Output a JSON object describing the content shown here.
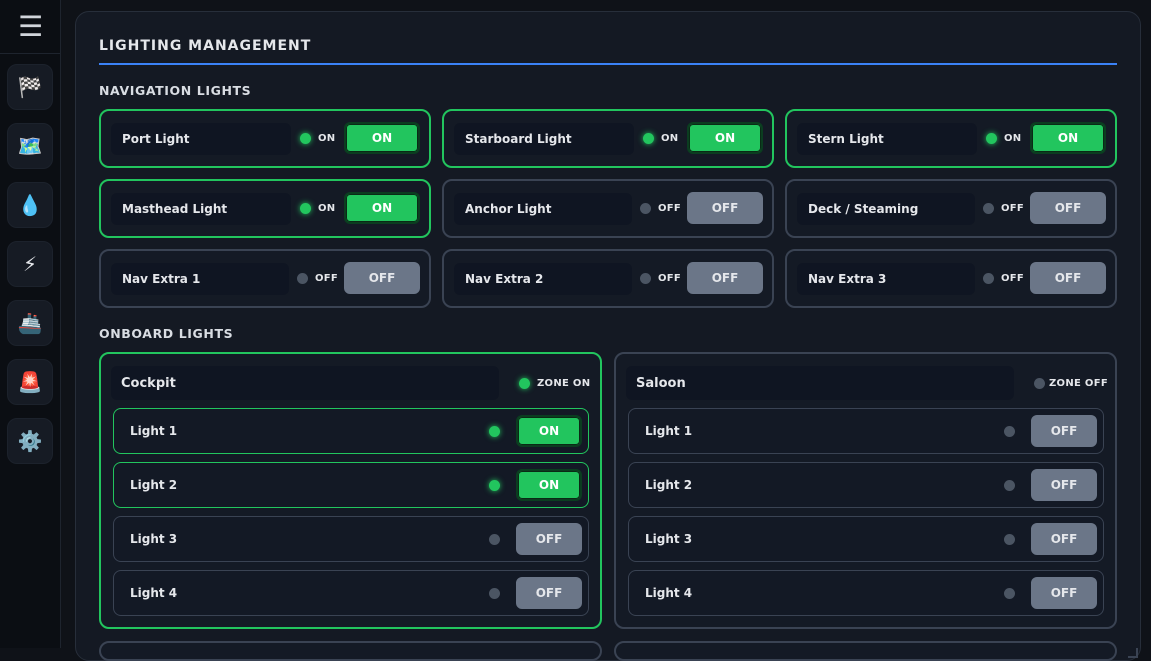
{
  "sidebar": {
    "menu_icon": "☰",
    "items": [
      {
        "name": "race-flag-icon",
        "glyph": "🏁"
      },
      {
        "name": "map-icon",
        "glyph": "🗺️"
      },
      {
        "name": "water-drop-icon",
        "glyph": "💧"
      },
      {
        "name": "lightning-icon",
        "glyph": "⚡"
      },
      {
        "name": "ship-icon",
        "glyph": "🚢"
      },
      {
        "name": "siren-icon",
        "glyph": "🚨"
      },
      {
        "name": "gear-icon",
        "glyph": "⚙️"
      }
    ]
  },
  "header": {
    "title": "LIGHTING MANAGEMENT"
  },
  "navigation": {
    "heading": "NAVIGATION LIGHTS",
    "lights": [
      {
        "label": "Port Light",
        "status": "ON",
        "button": "ON",
        "on": true
      },
      {
        "label": "Starboard Light",
        "status": "ON",
        "button": "ON",
        "on": true
      },
      {
        "label": "Stern Light",
        "status": "ON",
        "button": "ON",
        "on": true
      },
      {
        "label": "Masthead Light",
        "status": "ON",
        "button": "ON",
        "on": true
      },
      {
        "label": "Anchor Light",
        "status": "OFF",
        "button": "OFF",
        "on": false
      },
      {
        "label": "Deck / Steaming",
        "status": "OFF",
        "button": "OFF",
        "on": false
      },
      {
        "label": "Nav Extra 1",
        "status": "OFF",
        "button": "OFF",
        "on": false
      },
      {
        "label": "Nav Extra 2",
        "status": "OFF",
        "button": "OFF",
        "on": false
      },
      {
        "label": "Nav Extra 3",
        "status": "OFF",
        "button": "OFF",
        "on": false
      }
    ]
  },
  "onboard": {
    "heading": "ONBOARD LIGHTS",
    "zones": [
      {
        "name": "Cockpit",
        "status": "ZONE ON",
        "on": true,
        "lights": [
          {
            "label": "Light 1",
            "button": "ON",
            "on": true
          },
          {
            "label": "Light 2",
            "button": "ON",
            "on": true
          },
          {
            "label": "Light 3",
            "button": "OFF",
            "on": false
          },
          {
            "label": "Light 4",
            "button": "OFF",
            "on": false
          }
        ]
      },
      {
        "name": "Saloon",
        "status": "ZONE OFF",
        "on": false,
        "lights": [
          {
            "label": "Light 1",
            "button": "OFF",
            "on": false
          },
          {
            "label": "Light 2",
            "button": "OFF",
            "on": false
          },
          {
            "label": "Light 3",
            "button": "OFF",
            "on": false
          },
          {
            "label": "Light 4",
            "button": "OFF",
            "on": false
          }
        ]
      }
    ]
  },
  "colors": {
    "accent": "#3b82f6",
    "on": "#22c55e",
    "off": "#6b7688"
  }
}
